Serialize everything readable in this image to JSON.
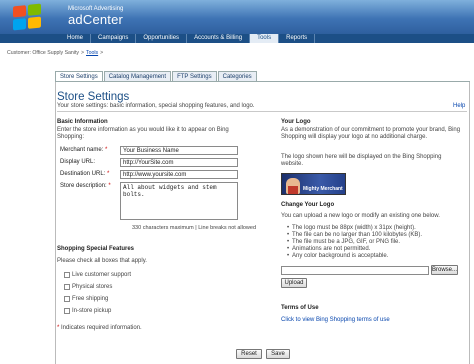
{
  "header": {
    "brand_small": "Microsoft Advertising",
    "brand_big": "adCenter",
    "logo_colors": [
      "#f25022",
      "#7fba00",
      "#00a4ef",
      "#ffb900"
    ]
  },
  "nav": {
    "tabs": [
      "Home",
      "Campaigns",
      "Opportunities",
      "Accounts & Billing",
      "Tools",
      "Reports"
    ],
    "active": "Tools"
  },
  "breadcrumb": {
    "customer": "Customer: Office Supply Sanity",
    "sep": ">",
    "link": "Tools",
    "tail": ">"
  },
  "page_tabs": [
    "Store Settings",
    "Catalog Management",
    "FTP Settings",
    "Categories"
  ],
  "title": "Store Settings",
  "subtitle": "Your store settings: basic information, special shopping features, and logo.",
  "help": "Help",
  "basic": {
    "heading": "Basic Information",
    "intro": "Enter the store information as you would like it to appear on Bing Shopping:",
    "merchant_label": "Merchant name:",
    "merchant_value": "Your Business Name",
    "display_label": "Display URL:",
    "display_value": "http://YourSite.com",
    "destination_label": "Destination URL:",
    "destination_value": "http://www.yoursite.com",
    "description_label": "Store description:",
    "description_line1": "All about widgets and stem",
    "description_line2": "bolts.",
    "char_note": "330 characters maximum | Line breaks not allowed",
    "required_mark": "*"
  },
  "features": {
    "heading": "Shopping Special Features",
    "intro": "Please check all boxes that apply.",
    "items": [
      "Live customer support",
      "Physical stores",
      "Free shipping",
      "In-store pickup"
    ],
    "required_note": "Indicates required information."
  },
  "logo": {
    "heading": "Your Logo",
    "desc": "As a demonstration of our commitment to promote your brand, Bing Shopping will display your logo at no additional charge.",
    "desc2": "The logo shown here will be displayed on the Bing Shopping website.",
    "image_text": "Mighty Merchant",
    "change_heading": "Change Your Logo",
    "change_intro": "You can upload a new logo or modify an existing one below.",
    "rules": [
      "The logo must be 88px (width) x 31px (height).",
      "The file can be no larger than 100 kilobytes (KB).",
      "The file must be a JPG, GIF, or PNG file.",
      "Animations are not permitted.",
      "Any color background is acceptable."
    ],
    "browse_label": "Browse...",
    "upload_label": "Upload"
  },
  "terms": {
    "heading": "Terms of Use",
    "link": "Click to view Bing Shopping terms of use"
  },
  "buttons": {
    "reset": "Reset",
    "save": "Save"
  }
}
